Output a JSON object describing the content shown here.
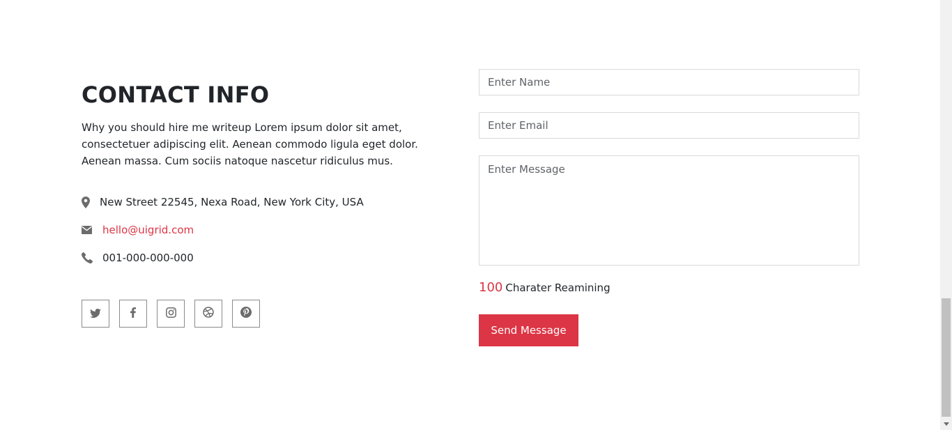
{
  "contact": {
    "title": "CONTACT INFO",
    "description": "Why you should hire me writeup Lorem ipsum dolor sit amet, consectetuer adipiscing elit. Aenean commodo ligula eget dolor. Aenean massa. Cum sociis natoque nascetur ridiculus mus.",
    "address": "New Street 22545, Nexa Road, New York City, USA",
    "email": "hello@uigrid.com",
    "phone": "001-000-000-000",
    "socials": [
      "twitter-icon",
      "facebook-icon",
      "instagram-icon",
      "dribbble-icon",
      "pinterest-icon"
    ]
  },
  "form": {
    "name_placeholder": "Enter Name",
    "email_placeholder": "Enter Email",
    "message_placeholder": "Enter Message",
    "counter_value": "100",
    "counter_label": "Charater Reamining",
    "send_label": "Send Message"
  },
  "colors": {
    "accent": "#dc3545",
    "text": "#212529",
    "icon": "#6c6c6c"
  }
}
